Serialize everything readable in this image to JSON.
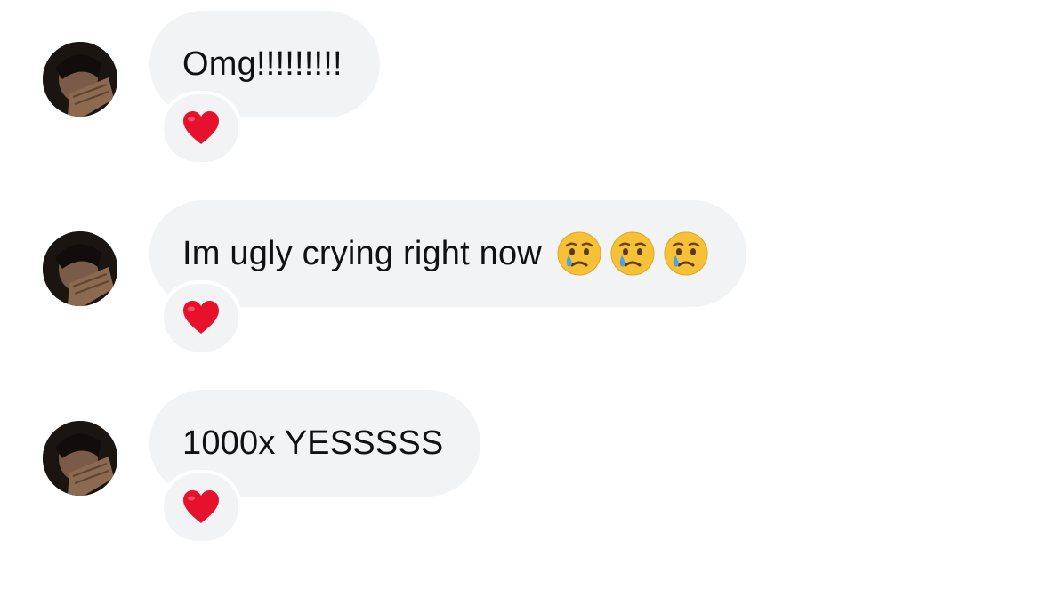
{
  "messages": [
    {
      "text": "Omg!!!!!!!!!",
      "emojis": [],
      "reaction": "heart-icon"
    },
    {
      "text": "Im ugly crying right now",
      "emojis": [
        "crying-face-icon",
        "crying-face-icon",
        "crying-face-icon"
      ],
      "reaction": "heart-icon"
    },
    {
      "text": "1000x YESSSSS",
      "emojis": [],
      "reaction": "heart-icon"
    }
  ],
  "colors": {
    "bubble": "#f2f3f5",
    "text": "#111111",
    "heart": "#e8112d",
    "emoji_face": "#f7c137",
    "tear": "#4aa3e8"
  }
}
